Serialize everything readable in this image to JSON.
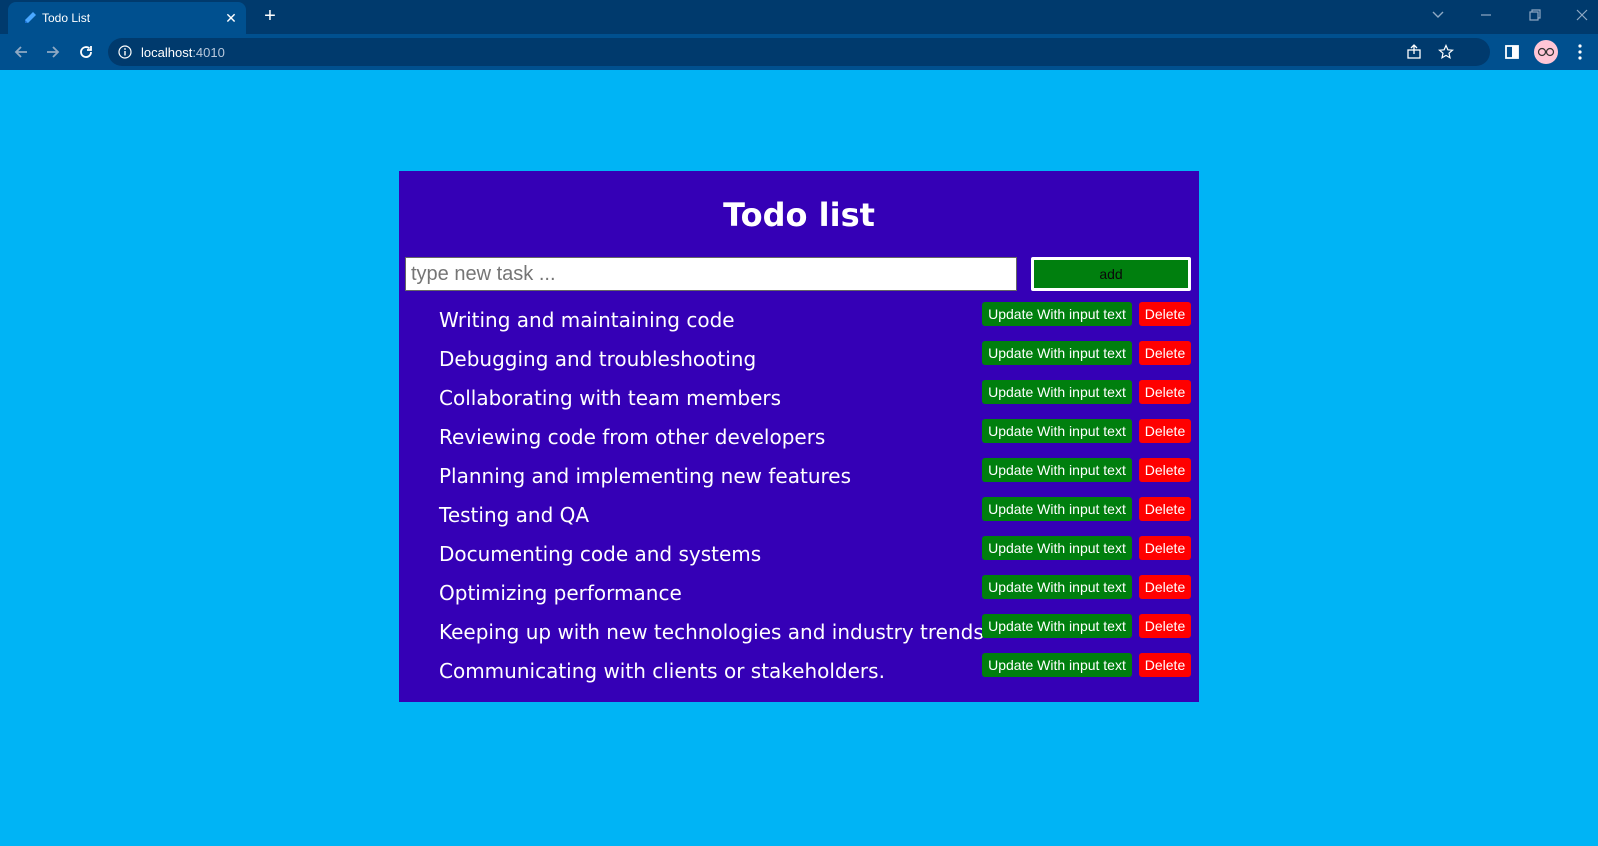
{
  "browser": {
    "tab_title": "Todo List",
    "url_host": "localhost",
    "url_port": ":4010"
  },
  "app": {
    "title": "Todo list",
    "input_placeholder": "type new task ...",
    "input_value": "",
    "add_label": "add",
    "update_label": "Update With input text",
    "delete_label": "Delete",
    "colors": {
      "page_background": "#00b4f5",
      "card_background": "#3500b6",
      "add_button": "#007f0e",
      "update_button": "#007f0e",
      "delete_button": "#ff0000"
    }
  },
  "todos": [
    "Writing and maintaining code",
    "Debugging and troubleshooting",
    "Collaborating with team members",
    "Reviewing code from other developers",
    "Planning and implementing new features",
    "Testing and QA",
    "Documenting code and systems",
    "Optimizing performance",
    "Keeping up with new technologies and industry trends",
    "Communicating with clients or stakeholders."
  ]
}
